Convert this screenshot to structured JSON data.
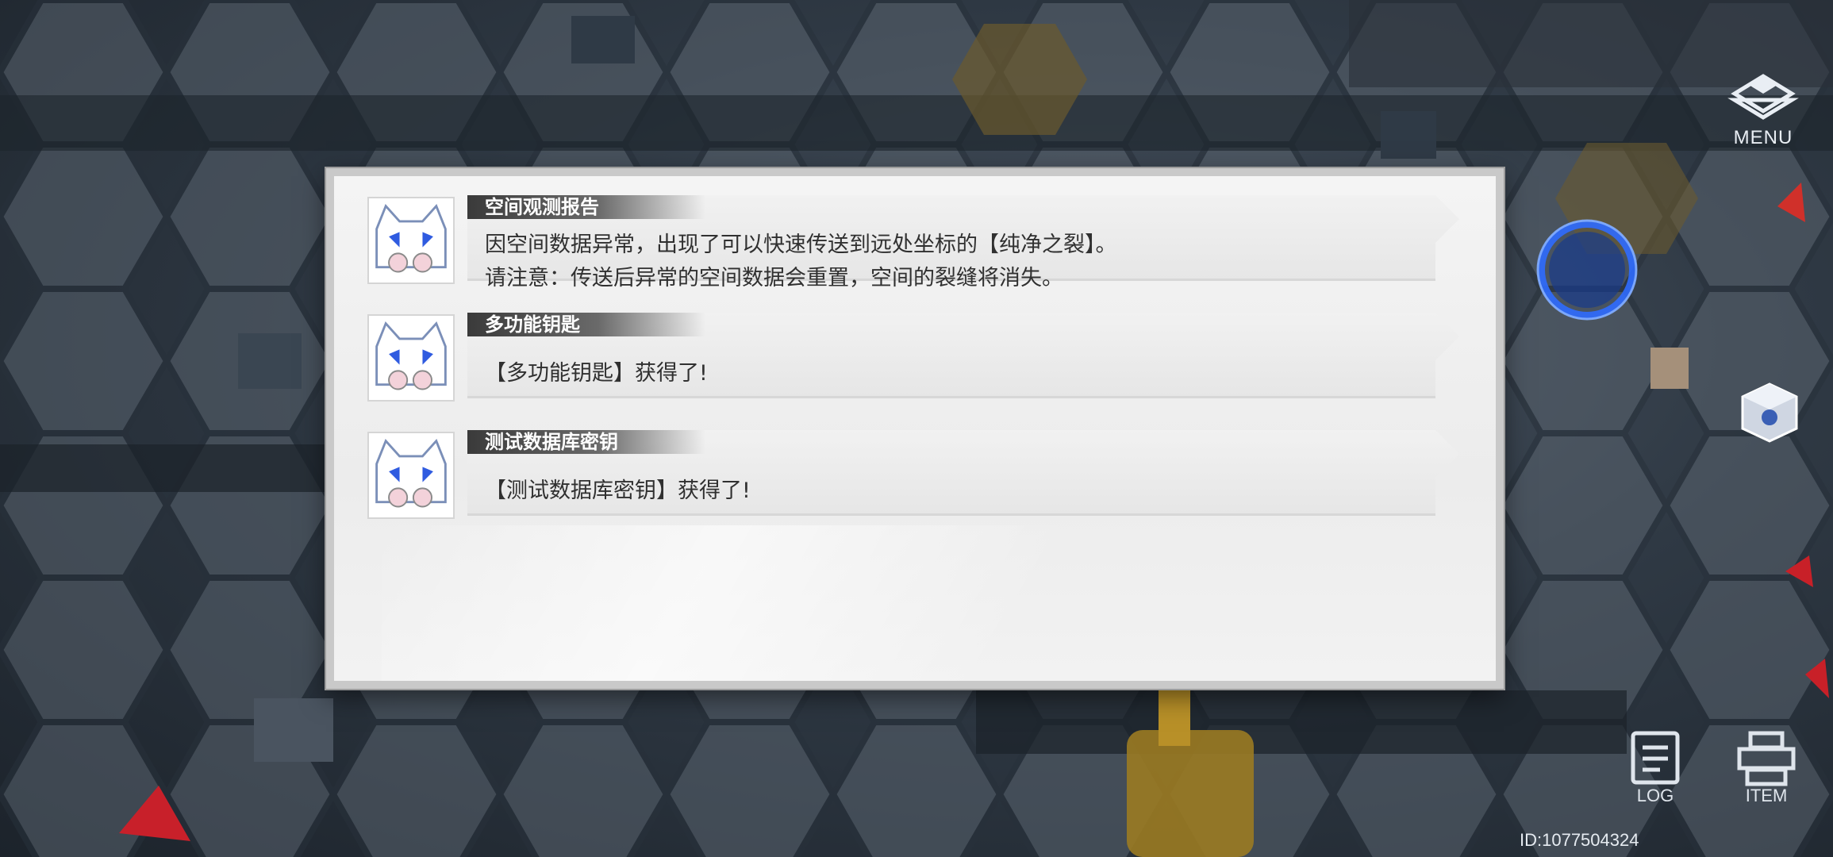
{
  "hud": {
    "menu_label": "MENU",
    "log_label": "LOG",
    "item_label": "ITEM",
    "player_id": "ID:1077504324"
  },
  "report": {
    "entries": [
      {
        "title": "空间观测报告",
        "lines": [
          "因空间数据异常，出现了可以快速传送到远处坐标的【纯净之裂】。",
          "请注意：传送后异常的空间数据会重置，空间的裂缝将消失。"
        ]
      },
      {
        "title": "多功能钥匙",
        "lines": [
          "【多功能钥匙】获得了!"
        ]
      },
      {
        "title": "测试数据库密钥",
        "lines": [
          "【测试数据库密钥】获得了!"
        ]
      }
    ]
  },
  "colors": {
    "panel_bg": "#ececec",
    "title_bar": "#3a3a3a",
    "portal_blue": "#2f6bff",
    "hud_text": "#e9eef4"
  },
  "icons": {
    "menu": "diamond-cube-icon",
    "log": "document-icon",
    "item": "printer-tray-icon",
    "avatar": "cat-mascot-icon",
    "portal": "portal-ring-icon"
  }
}
